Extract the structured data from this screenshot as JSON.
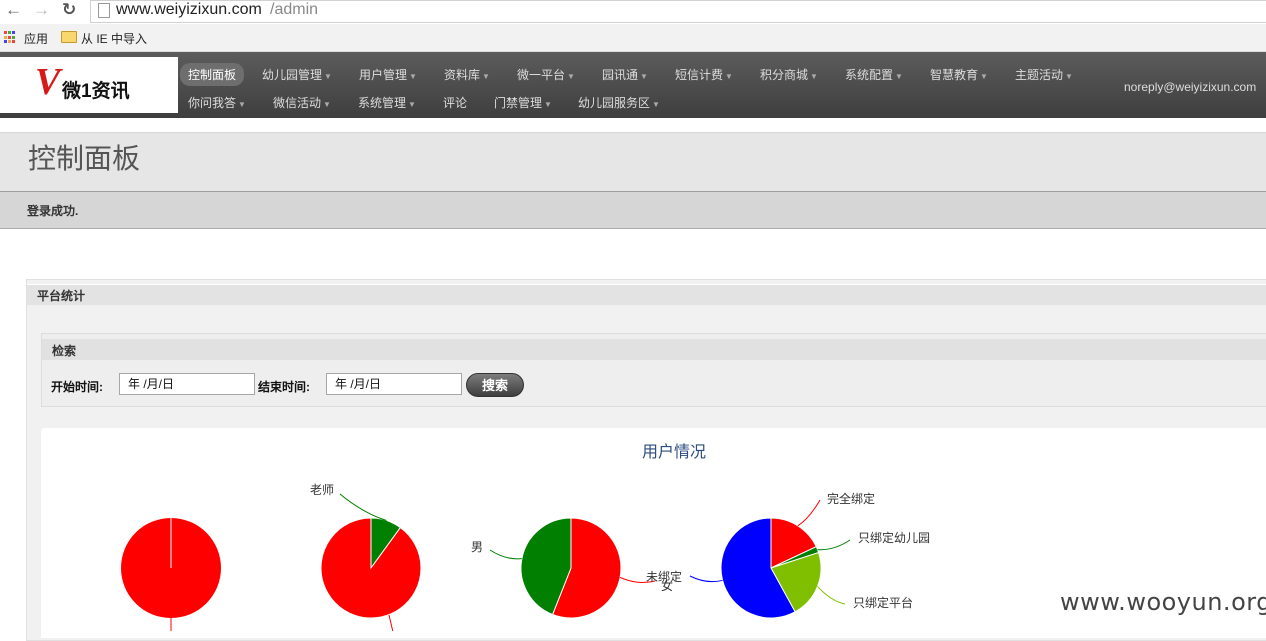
{
  "browser": {
    "url_host": "www.weiyizixun.com",
    "url_path": "/admin",
    "back_glyph": "←",
    "forward_glyph": "→",
    "reload_glyph": "↻",
    "bookmarks": [
      "应用",
      "从 IE 中导入"
    ]
  },
  "header": {
    "logo_mark": "V",
    "logo_text": "微1资讯",
    "user_email": "noreply@weiyizixun.com",
    "menu_row1": [
      {
        "label": "控制面板",
        "active": true,
        "has_caret": false
      },
      {
        "label": "幼儿园管理",
        "has_caret": true
      },
      {
        "label": "用户管理",
        "has_caret": true
      },
      {
        "label": "资料库",
        "has_caret": true
      },
      {
        "label": "微一平台",
        "has_caret": true
      },
      {
        "label": "园讯通",
        "has_caret": true
      },
      {
        "label": "短信计费",
        "has_caret": true
      },
      {
        "label": "积分商城",
        "has_caret": true
      },
      {
        "label": "系统配置",
        "has_caret": true
      },
      {
        "label": "智慧教育",
        "has_caret": true
      },
      {
        "label": "主题活动",
        "has_caret": true
      }
    ],
    "menu_row2": [
      {
        "label": "你问我答",
        "has_caret": true
      },
      {
        "label": "微信活动",
        "has_caret": true
      },
      {
        "label": "系统管理",
        "has_caret": true
      },
      {
        "label": "评论",
        "has_caret": false
      },
      {
        "label": "门禁管理",
        "has_caret": true
      },
      {
        "label": "幼儿园服务区",
        "has_caret": true
      }
    ]
  },
  "page": {
    "title": "控制面板",
    "message": "登录成功."
  },
  "stats": {
    "panel_title": "平台统计",
    "search": {
      "title": "检索",
      "start_label": "开始时间:",
      "start_value": "年 /月/日",
      "end_label": "结束时间:",
      "end_value": "年 /月/日",
      "button": "搜索"
    }
  },
  "chart_data": {
    "type": "pie",
    "title": "用户情况",
    "pies": [
      {
        "slices": [
          {
            "label": "",
            "fraction": 1.0,
            "color": "#ff0000"
          }
        ]
      },
      {
        "slices": [
          {
            "label": "老师",
            "fraction": 0.1,
            "color": "#007f00"
          },
          {
            "label": "",
            "fraction": 0.9,
            "color": "#ff0000"
          }
        ]
      },
      {
        "slices": [
          {
            "label": "女",
            "fraction": 0.56,
            "color": "#ff0000"
          },
          {
            "label": "男",
            "fraction": 0.44,
            "color": "#007f00"
          }
        ]
      },
      {
        "slices": [
          {
            "label": "完全绑定",
            "fraction": 0.18,
            "color": "#ff0000"
          },
          {
            "label": "只绑定幼儿园",
            "fraction": 0.02,
            "color": "#007f00"
          },
          {
            "label": "只绑定平台",
            "fraction": 0.22,
            "color": "#7fbf00"
          },
          {
            "label": "未绑定",
            "fraction": 0.58,
            "color": "#0000ff"
          }
        ]
      }
    ]
  },
  "watermark": "www.wooyun.org"
}
